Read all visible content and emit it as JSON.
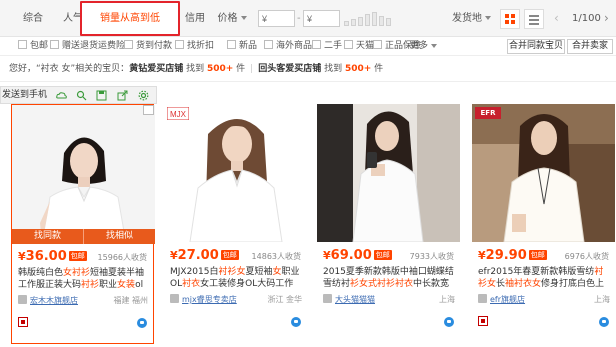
{
  "sortbar": {
    "tabs": [
      {
        "label": "综合"
      },
      {
        "label": "人气"
      },
      {
        "label": "销量从高到低"
      },
      {
        "label": "信用"
      },
      {
        "label": "价格"
      }
    ],
    "price_from_placeholder": "¥",
    "price_to_placeholder": "¥",
    "dash": "-",
    "ship_from": "发货地",
    "pager": {
      "prev": "‹",
      "text": "1/100",
      "next": "›"
    }
  },
  "filters": {
    "items": [
      "包邮",
      "赠送退货运费险",
      "货到付款",
      "找折扣",
      "新品",
      "海外商品",
      "二手",
      "天猫",
      "正品保障"
    ],
    "more": "更多",
    "combine_same": "合并同款宝贝",
    "combine_seller": "合并卖家"
  },
  "notice": {
    "prefix": "您好，“衬衣 女”相关的宝贝：",
    "shop1": "黄钻爱买店铺",
    "mid1": " 找到 ",
    "count1": "500+",
    "suffix1": " 件",
    "sep": "|",
    "shop2": "回头客爱买店铺",
    "mid2": " 找到 ",
    "count2": "500+",
    "suffix2": " 件"
  },
  "toolbar": {
    "send_to_phone": "发送到手机"
  },
  "products": [
    {
      "yen": "¥",
      "price": "36.00",
      "baoyou": "包邮",
      "sales": "15966人收货",
      "title_a": "韩版纯白色",
      "title_k1": "女衬衫",
      "title_b": "短袖夏装半袖工作服正装大码",
      "title_k2": "衬衫",
      "title_c": "职业",
      "title_k3": "女装",
      "title_d": "ol",
      "shop": "宏木木旗舰店",
      "location": "福建 福州",
      "btn_same": "找同款",
      "btn_similar": "找相似"
    },
    {
      "yen": "¥",
      "price": "27.00",
      "baoyou": "包邮",
      "sales": "14863人收货",
      "title_a": "MJX2015白",
      "title_k1": "衬衫女",
      "title_b": "夏短袖",
      "title_k2": "女",
      "title_c": "职业OL",
      "title_k3": "衬衣",
      "title_d": "女工装修身OL大码工作服职业装",
      "shop": "mjx睿思专卖店",
      "location": "浙江 金华",
      "logo": "MJX"
    },
    {
      "yen": "¥",
      "price": "69.00",
      "baoyou": "包邮",
      "sales": "7933人收货",
      "title_a": "2015夏季新款韩版中袖口蝴蝶结雪纺衬",
      "title_k1": "衫女",
      "title_b": "",
      "title_k2": "式衬衫衬衣",
      "title_c": "中长款宽松圆领上衣潮",
      "title_k3": "",
      "title_d": "",
      "shop": "大头猫猫猫",
      "location": "上海"
    },
    {
      "yen": "¥",
      "price": "29.90",
      "baoyou": "包邮",
      "sales": "6976人收货",
      "title_a": "efr2015年春夏新款韩版雪纺",
      "title_k1": "衬衫女",
      "title_b": "长",
      "title_k2": "袖衬衣女",
      "title_c": "修身打底白色上衣",
      "title_k3": "",
      "title_d": "",
      "shop": "efr旗舰店",
      "location": "上海",
      "logo": "EFR"
    }
  ],
  "colors": {
    "accent": "#ff4400",
    "highlight_box": "#e3242b",
    "shop_link": "#3c6bb2"
  }
}
